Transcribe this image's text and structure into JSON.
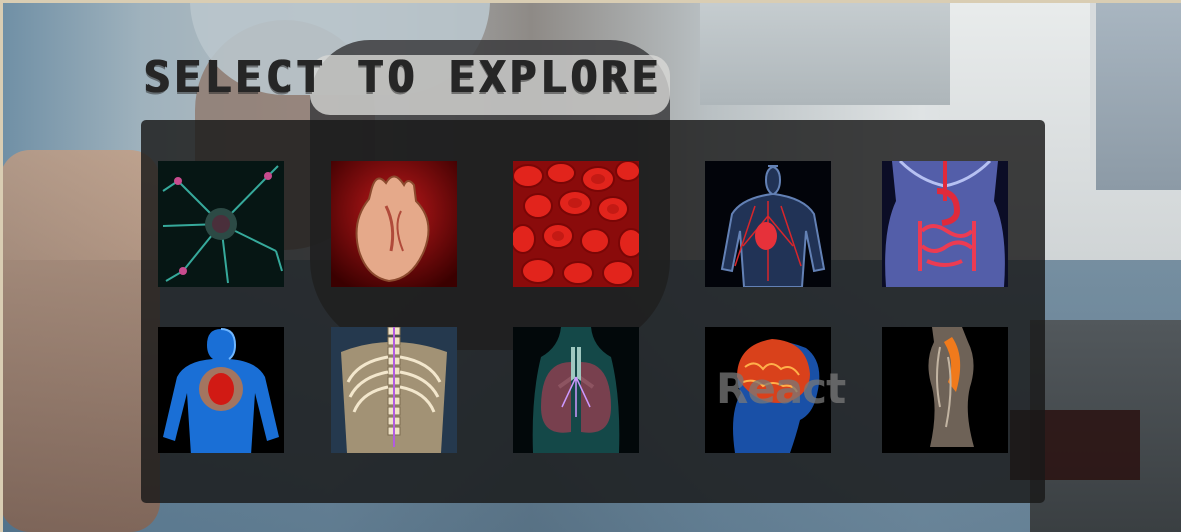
{
  "page": {
    "title": "SELECT TO EXPLORE",
    "watermark": "React"
  },
  "colors": {
    "panel": "#181818",
    "title": "#262626",
    "tile_background": "#000000"
  },
  "tiles": [
    {
      "id": "neuron",
      "icon": "neuron-icon"
    },
    {
      "id": "heart",
      "icon": "heart-anatomy-icon"
    },
    {
      "id": "blood-cells",
      "icon": "red-blood-cells-icon"
    },
    {
      "id": "circulatory-system",
      "icon": "circulatory-system-icon"
    },
    {
      "id": "digestive-system",
      "icon": "digestive-system-icon"
    },
    {
      "id": "human-heart-body",
      "icon": "body-heart-icon"
    },
    {
      "id": "skeletal-system",
      "icon": "spine-skeleton-icon"
    },
    {
      "id": "lungs",
      "icon": "lungs-icon"
    },
    {
      "id": "brain",
      "icon": "brain-icon"
    },
    {
      "id": "back-muscles",
      "icon": "back-muscles-icon"
    }
  ]
}
